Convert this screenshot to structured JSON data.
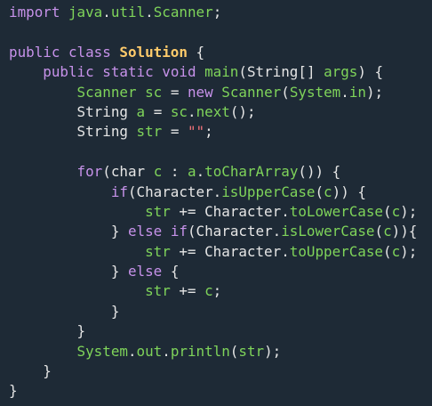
{
  "colors": {
    "background": "#1e2a36",
    "keyword": "#c792ea",
    "class_name": "#ffcb6b",
    "identifier": "#7fd45a",
    "string": "#f07178",
    "operator": "#89ddff",
    "plain": "#e6e6e6"
  },
  "code": {
    "l1": {
      "kw": "import",
      "pkg1": "java",
      "d1": ".",
      "pkg2": "util",
      "d2": ".",
      "cls": "Scanner",
      "end": ";"
    },
    "l3": {
      "kw1": "public",
      "kw2": "class",
      "cls": "Solution",
      "brace": "{"
    },
    "l4": {
      "kw1": "public",
      "kw2": "static",
      "kw3": "void",
      "fn": "main",
      "p1": "(",
      "type": "String[]",
      "arg": "args",
      "p2": ") {"
    },
    "l5": {
      "type1": "Scanner",
      "var": "sc",
      "eq": "=",
      "kw": "new",
      "type2": "Scanner",
      "p1": "(",
      "sys": "System",
      "dot": ".",
      "in": "in",
      "p2": ");"
    },
    "l6": {
      "type": "String",
      "var": "a",
      "eq": "=",
      "obj": "sc",
      "dot": ".",
      "fn": "next",
      "p": "();"
    },
    "l7": {
      "type": "String",
      "var": "str",
      "eq": "=",
      "str": "\"\"",
      "end": ";"
    },
    "l9": {
      "kw": "for",
      "p1": "(",
      "kw2": "char",
      "var": "c",
      "colon": ":",
      "obj": "a",
      "dot": ".",
      "fn": "toCharArray",
      "p2": "()) {"
    },
    "l10": {
      "kw": "if",
      "p1": "(",
      "cls": "Character",
      "dot": ".",
      "fn": "isUpperCase",
      "p2": "(",
      "var": "c",
      "p3": ")) {"
    },
    "l11": {
      "var": "str",
      "op": "+=",
      "cls": "Character",
      "dot": ".",
      "fn": "toLowerCase",
      "p1": "(",
      "arg": "c",
      "p2": ");"
    },
    "l12": {
      "b": "}",
      "kw1": "else",
      "kw2": "if",
      "p1": "(",
      "cls": "Character",
      "dot": ".",
      "fn": "isLowerCase",
      "p2": "(",
      "var": "c",
      "p3": ")){"
    },
    "l13": {
      "var": "str",
      "op": "+=",
      "cls": "Character",
      "dot": ".",
      "fn": "toUpperCase",
      "p1": "(",
      "arg": "c",
      "p2": ");"
    },
    "l14": {
      "b": "}",
      "kw": "else",
      "b2": "{"
    },
    "l15": {
      "var": "str",
      "op": "+=",
      "arg": "c",
      "end": ";"
    },
    "l16": {
      "b": "}"
    },
    "l17": {
      "b": "}"
    },
    "l18": {
      "sys": "System",
      "d1": ".",
      "out": "out",
      "d2": ".",
      "fn": "println",
      "p1": "(",
      "arg": "str",
      "p2": ");"
    },
    "l19": {
      "b": "}"
    },
    "l20": {
      "b": "}"
    }
  }
}
